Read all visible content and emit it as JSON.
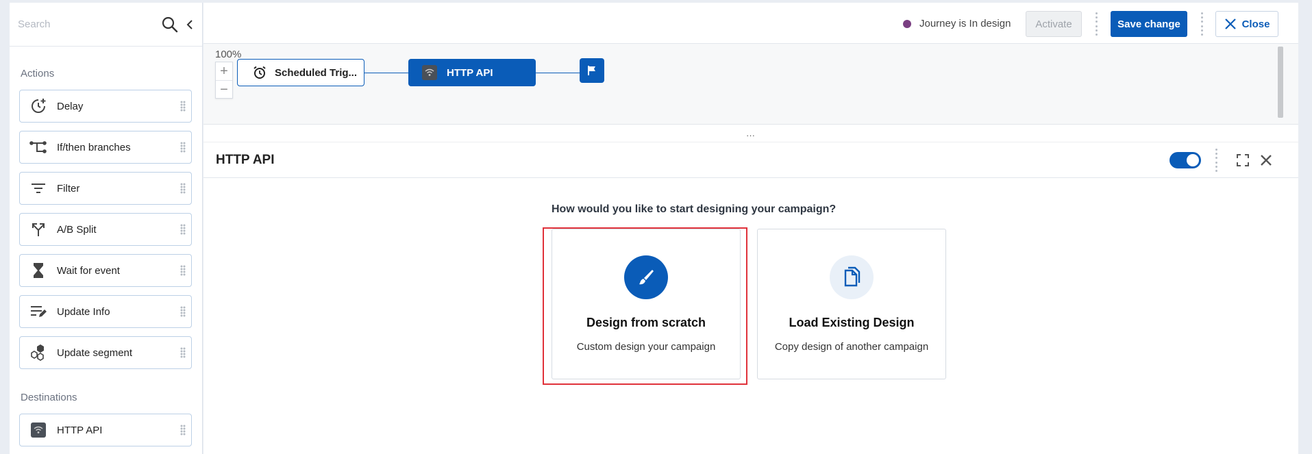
{
  "sidebar": {
    "search_placeholder": "Search",
    "actions_label": "Actions",
    "actions": [
      {
        "label": "Delay",
        "icon": "clock-plus-icon"
      },
      {
        "label": "If/then branches",
        "icon": "branch-icon"
      },
      {
        "label": "Filter",
        "icon": "filter-icon"
      },
      {
        "label": "A/B Split",
        "icon": "split-icon"
      },
      {
        "label": "Wait for event",
        "icon": "hourglass-icon"
      },
      {
        "label": "Update Info",
        "icon": "edit-lines-icon"
      },
      {
        "label": "Update segment",
        "icon": "segment-icon"
      }
    ],
    "destinations_label": "Destinations",
    "destinations": [
      {
        "label": "HTTP API",
        "icon": "wifi-icon"
      }
    ]
  },
  "topbar": {
    "status_text": "Journey is In design",
    "status_color": "#7a3f82",
    "activate_label": "Activate",
    "save_label": "Save change",
    "close_label": "Close"
  },
  "canvas": {
    "zoom": "100%",
    "zoom_in": "+",
    "zoom_out": "−",
    "nodes": {
      "trigger": "Scheduled Trig...",
      "http": "HTTP API"
    }
  },
  "resize_handle": "...",
  "panel": {
    "title": "HTTP API",
    "enabled": true,
    "question": "How would you like to start designing your campaign?",
    "options": [
      {
        "title": "Design from scratch",
        "description": "Custom design your campaign",
        "highlighted": true
      },
      {
        "title": "Load Existing Design",
        "description": "Copy design of another campaign",
        "highlighted": false
      }
    ]
  },
  "colors": {
    "primary": "#0a5cb8",
    "highlight": "#e0313a"
  }
}
